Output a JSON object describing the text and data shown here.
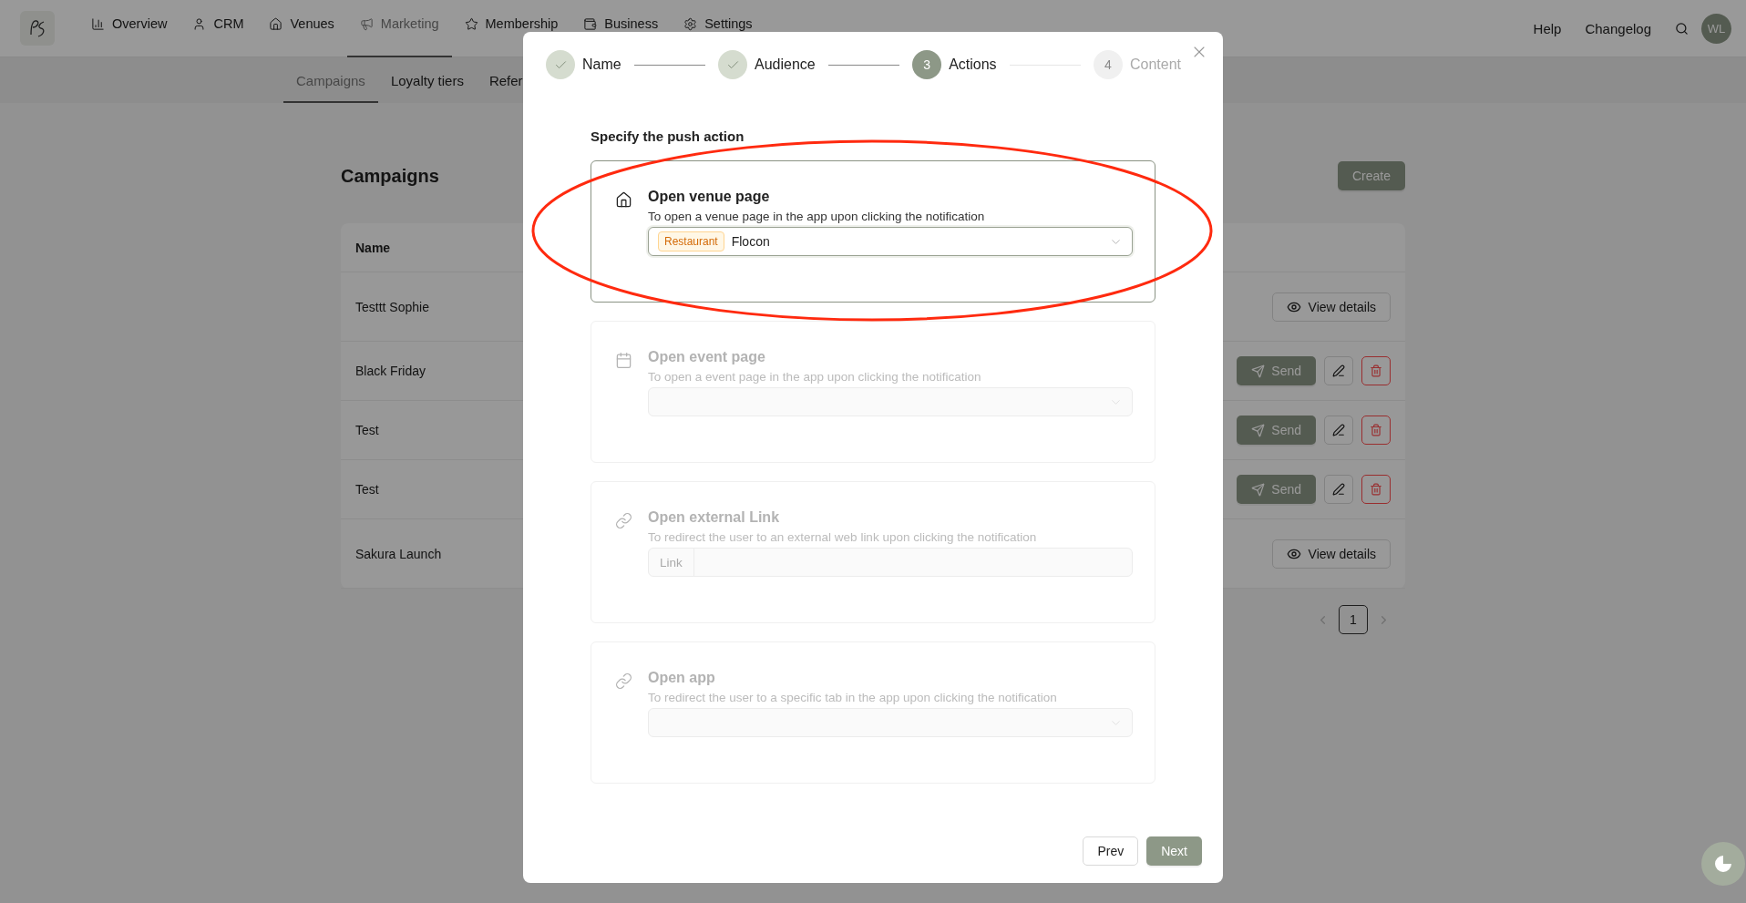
{
  "nav": {
    "items": [
      {
        "label": "Overview",
        "selected": false
      },
      {
        "label": "CRM",
        "selected": false
      },
      {
        "label": "Venues",
        "selected": false
      },
      {
        "label": "Marketing",
        "selected": true
      },
      {
        "label": "Membership",
        "selected": false
      },
      {
        "label": "Business",
        "selected": false
      },
      {
        "label": "Settings",
        "selected": false
      }
    ],
    "right_links": [
      "Help",
      "Changelog"
    ],
    "avatar": "WL"
  },
  "subnav": [
    {
      "label": "Campaigns",
      "selected": true
    },
    {
      "label": "Loyalty tiers",
      "selected": false
    },
    {
      "label": "Refer",
      "selected": false
    }
  ],
  "page": {
    "title": "Campaigns",
    "create_button": "Create"
  },
  "table": {
    "columns": [
      "Name"
    ],
    "rows": [
      {
        "name": "Testtt Sophie",
        "kind": "view",
        "action": "View details"
      },
      {
        "name": "Black Friday",
        "kind": "draft",
        "action": "Send"
      },
      {
        "name": "Test",
        "kind": "draft",
        "action": "Send"
      },
      {
        "name": "Test",
        "kind": "draft",
        "action": "Send"
      },
      {
        "name": "Sakura Launch",
        "kind": "view",
        "action": "View details"
      }
    ]
  },
  "pagination": {
    "pages": [
      {
        "label": "1",
        "selected": true
      }
    ]
  },
  "modal": {
    "steps": [
      {
        "label": "Name",
        "completed": true,
        "selected": false
      },
      {
        "label": "Audience",
        "completed": true,
        "selected": false
      },
      {
        "number": "3",
        "label": "Actions",
        "completed": false,
        "selected": true
      },
      {
        "number": "4",
        "label": "Content",
        "completed": false,
        "selected": false
      }
    ],
    "heading": "Specify the push action",
    "options": [
      {
        "title": "Open venue page",
        "description": "To open a venue page in the app upon clicking the notification",
        "selected": true,
        "field": {
          "kind": "select",
          "tag": "Restaurant",
          "value": "Flocon"
        }
      },
      {
        "title": "Open event page",
        "description": "To open a event page in the app upon clicking the notification",
        "selected": false,
        "field": {
          "kind": "select"
        }
      },
      {
        "title": "Open external Link",
        "description": "To redirect the user to an external web link upon clicking the notification",
        "selected": false,
        "field": {
          "kind": "link",
          "addon": "Link"
        }
      },
      {
        "title": "Open app",
        "description": "To redirect the user to a specific tab in the app upon clicking the notification",
        "selected": false,
        "field": {
          "kind": "select"
        }
      }
    ],
    "prev_button": "Prev",
    "next_button": "Next"
  }
}
